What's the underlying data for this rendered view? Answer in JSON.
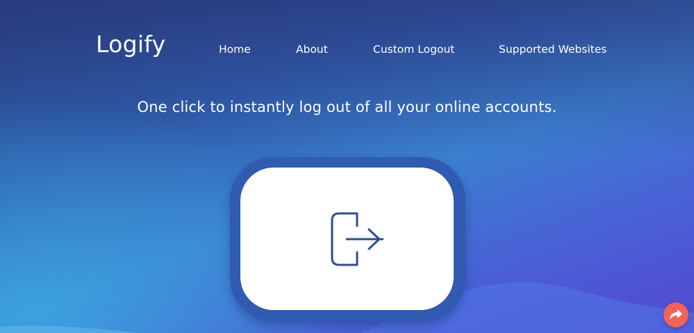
{
  "brand": {
    "name": "Logify"
  },
  "nav": {
    "items": [
      {
        "label": "Home"
      },
      {
        "label": "About"
      },
      {
        "label": "Custom Logout"
      },
      {
        "label": "Supported Websites"
      }
    ]
  },
  "hero": {
    "tagline": "One click to instantly log out of all your online accounts.",
    "logout_icon": "logout-icon"
  },
  "share": {
    "icon": "share-arrow-icon"
  },
  "colors": {
    "background_top": "#2a4a8e",
    "background_bottom": "#5248d0",
    "button_frame": "#2f5bb0",
    "button_face": "#ffffff",
    "icon_stroke": "#2d4f8e",
    "share_button": "#f0625a",
    "text": "#ffffff"
  }
}
